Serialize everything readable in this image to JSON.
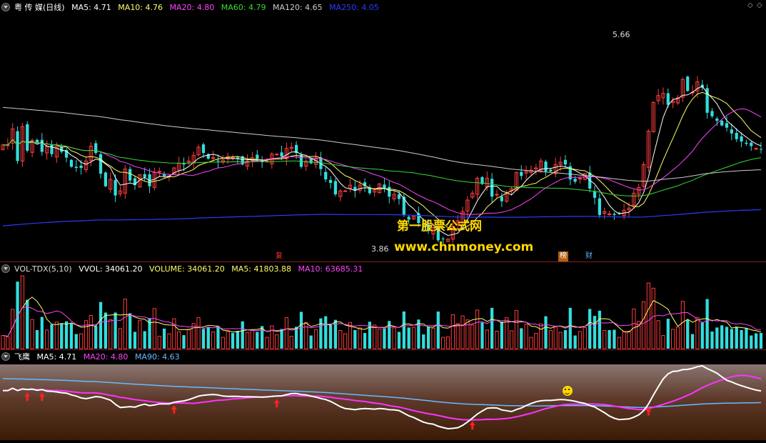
{
  "main_header": {
    "caret": "",
    "title": "粤 传 媒(日线)",
    "ma": [
      {
        "label": "MA5: 4.71",
        "color": "#ffffff"
      },
      {
        "label": "MA10: 4.76",
        "color": "#ffff66"
      },
      {
        "label": "MA20: 4.80",
        "color": "#ff44ff"
      },
      {
        "label": "MA60: 4.79",
        "color": "#33dd33"
      },
      {
        "label": "MA120: 4.65",
        "color": "#cccccc"
      },
      {
        "label": "MA250: 4.05",
        "color": "#2a3cff"
      }
    ]
  },
  "volume_header": {
    "title": "VOL-TDX(5,10)",
    "vvol": "VVOL: 34061.20",
    "volume": "VOLUME: 34061.20",
    "ma5": "MA5: 41803.88",
    "ma10": "MA10: 63685.31"
  },
  "indicator_header": {
    "title": "飞鹰",
    "ma5": "MA5: 4.71",
    "ma20": "MA20: 4.80",
    "ma90": "MA90: 4.63"
  },
  "watermark": {
    "line1": "第一股票公式网",
    "line2": "www.chnmoney.com"
  },
  "markers": {
    "high_price": "5.66",
    "low_price": "3.86",
    "tag_bang": "榜",
    "tag_cai": "财",
    "tag_fu": "复"
  },
  "colors": {
    "up": "#ff3c3c",
    "down": "#33dddd",
    "accent_text": "#ffd800"
  },
  "chart_data": {
    "type": "candlestick",
    "price_ylim": [
      3.76,
      5.9
    ],
    "close": [
      4.75,
      4.75,
      4.89,
      4.61,
      4.91,
      4.7,
      4.79,
      4.77,
      4.69,
      4.74,
      4.67,
      4.74,
      4.69,
      4.64,
      4.56,
      4.55,
      4.55,
      4.61,
      4.74,
      4.68,
      4.5,
      4.39,
      4.45,
      4.31,
      4.35,
      4.54,
      4.44,
      4.4,
      4.49,
      4.47,
      4.39,
      4.51,
      4.52,
      4.48,
      4.48,
      4.55,
      4.59,
      4.58,
      4.61,
      4.66,
      4.73,
      4.68,
      4.63,
      4.64,
      4.61,
      4.62,
      4.65,
      4.64,
      4.63,
      4.58,
      4.61,
      4.64,
      4.63,
      4.6,
      4.61,
      4.67,
      4.67,
      4.65,
      4.72,
      4.73,
      4.68,
      4.56,
      4.61,
      4.59,
      4.63,
      4.54,
      4.45,
      4.42,
      4.32,
      4.35,
      4.35,
      4.4,
      4.35,
      4.4,
      4.39,
      4.33,
      4.36,
      4.41,
      4.37,
      4.3,
      4.32,
      4.28,
      4.14,
      4.1,
      4.13,
      4.07,
      4.05,
      4.0,
      4.03,
      3.92,
      3.93,
      3.93,
      4.04,
      4.09,
      4.17,
      4.27,
      4.33,
      4.46,
      4.41,
      4.46,
      4.3,
      4.32,
      4.26,
      4.33,
      4.37,
      4.51,
      4.48,
      4.52,
      4.53,
      4.55,
      4.61,
      4.52,
      4.52,
      4.58,
      4.6,
      4.58,
      4.45,
      4.43,
      4.46,
      4.5,
      4.37,
      4.29,
      4.14,
      4.17,
      4.15,
      4.14,
      4.15,
      4.18,
      4.2,
      4.33,
      4.38,
      4.58,
      4.87,
      5.12,
      5.18,
      5.2,
      5.1,
      5.13,
      5.16,
      5.32,
      5.22,
      5.21,
      5.3,
      5.25,
      5.03,
      5.0,
      4.96,
      4.92,
      4.9,
      4.85,
      4.8,
      4.78,
      4.76,
      4.74,
      4.72,
      4.71
    ]
  }
}
